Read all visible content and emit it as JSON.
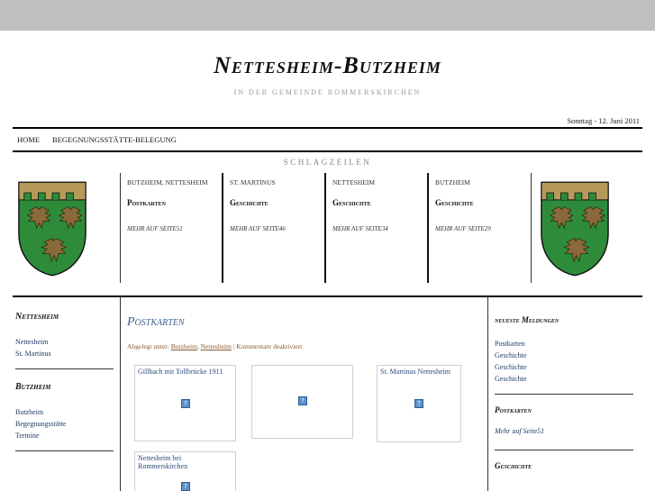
{
  "site": {
    "title": "Nettesheim-Butzheim",
    "subtitle": "in der Gemeinde Rommerskirchen",
    "date": "Sonntag - 12. Juni 2011"
  },
  "nav": {
    "items": [
      {
        "label": "Home"
      },
      {
        "label": "Begegnungsstätte-Belegung"
      }
    ]
  },
  "headlines": {
    "heading": "Schlagzeilen",
    "columns": [
      {
        "category": "Butzheim, Nettesheim",
        "title": "Postkarten",
        "more": "Mehr auf Seite51"
      },
      {
        "category": "St. Martinus",
        "title": "Geschichte",
        "more": "Mehr auf Seite46"
      },
      {
        "category": "Nettesheim",
        "title": "Geschichte",
        "more": "Mehr auf Seite34"
      },
      {
        "category": "Butzheim",
        "title": "Geschichte",
        "more": "Mehr auf Seite29"
      }
    ]
  },
  "sidebar_left": {
    "widgets": [
      {
        "title": "Nettesheim",
        "items": [
          "Nettesheim",
          "St. Martinus"
        ]
      },
      {
        "title": "Butzheim",
        "items": [
          "Butzheim",
          "Begegnungsstätte",
          "Termine"
        ]
      }
    ]
  },
  "main": {
    "post_title": "Postkarten",
    "meta_prefix": "Abgelegt unter:",
    "meta_link1": "Butzheim",
    "meta_sep": ",",
    "meta_link2": "Nettesheim",
    "meta_suffix": "| Kommentare deaktiviert",
    "thumbnails": [
      {
        "caption": "Gillbach mit Tollbrücke 1911"
      },
      {
        "caption": ""
      },
      {
        "caption": "St. Martinus Nettesheim"
      },
      {
        "caption": "Nettesheim bei Rommerskirchen"
      }
    ],
    "broken_image_icon": "?"
  },
  "sidebar_right": {
    "news_title": "neueste Meldungen",
    "news_items": [
      "Postkarten",
      "Geschichte",
      "Geschichte",
      "Geschichte"
    ],
    "postkarten_title": "Postkarten",
    "postkarten_more": "Mehr auf Seite51",
    "geschichte_title": "Geschichte"
  },
  "colors": {
    "topbar": "#bfbfbf",
    "link": "#1f3a63",
    "post_title": "#3f5f8a",
    "meta": "#8a5a30",
    "crest_green": "#2e8b3a",
    "crest_top": "#b59a5a"
  },
  "icons": {
    "crest": "coat-of-arms",
    "broken_image": "broken-image-icon"
  }
}
